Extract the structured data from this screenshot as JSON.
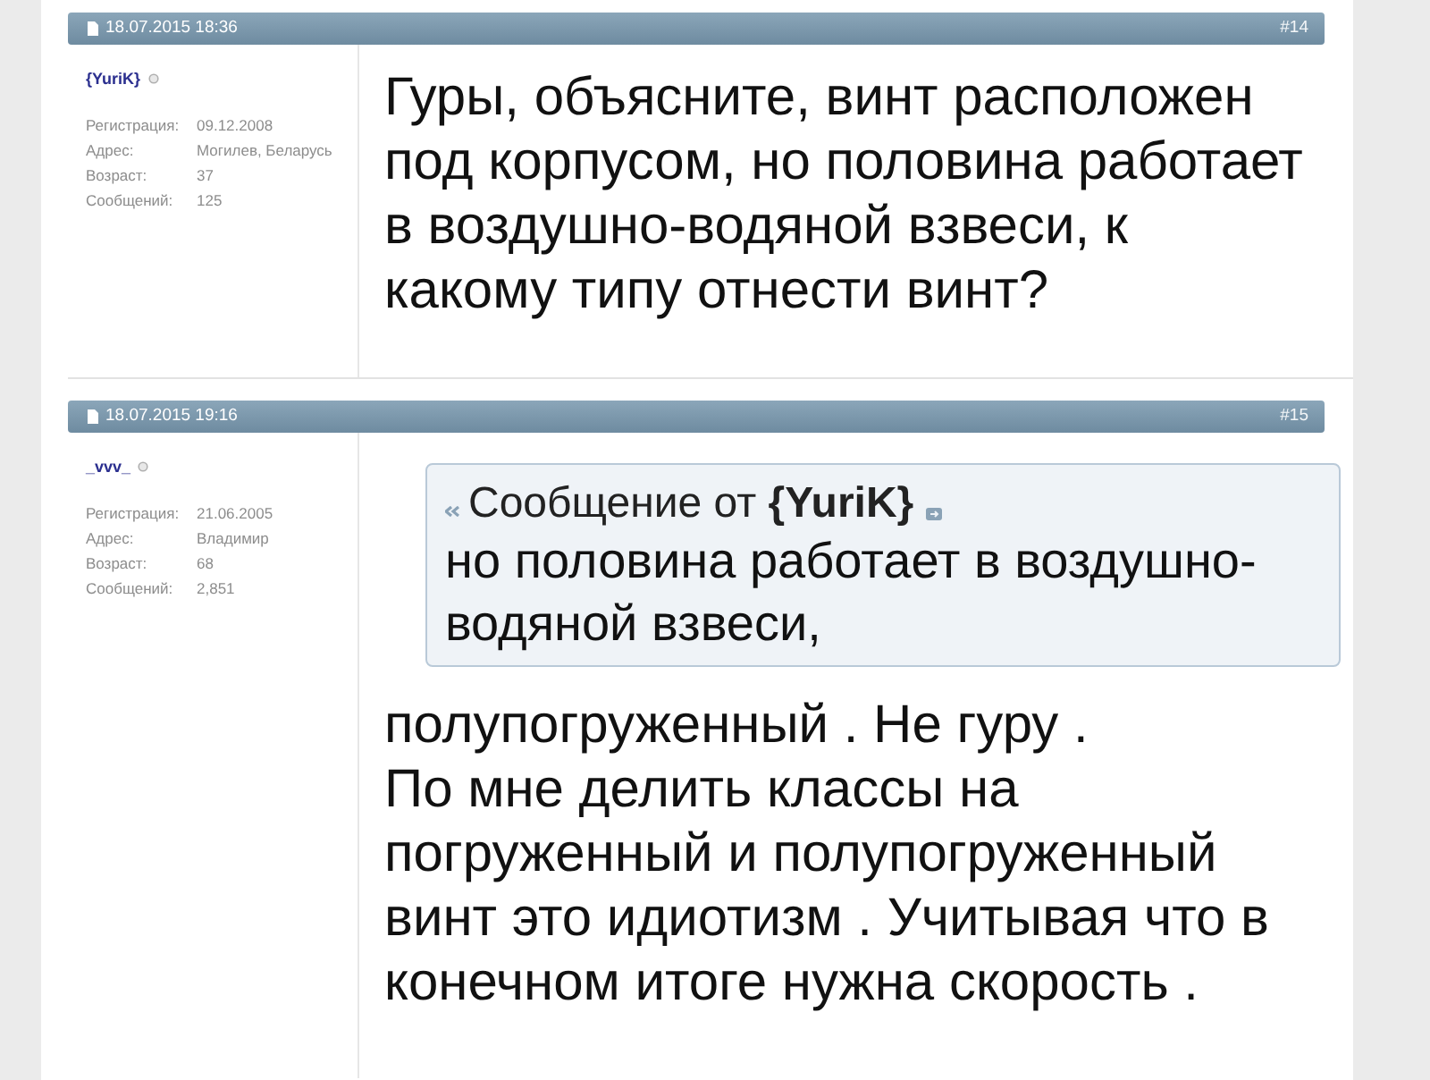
{
  "posts": [
    {
      "date": "18.07.2015 18:36",
      "number": "#14",
      "user": {
        "name": "{YuriK}",
        "online": false,
        "info": [
          {
            "label": "Регистрация:",
            "value": "09.12.2008"
          },
          {
            "label": "Адрес:",
            "value": "Могилев, Беларусь"
          },
          {
            "label": "Возраст:",
            "value": "37"
          },
          {
            "label": "Сообщений:",
            "value": "125"
          }
        ]
      },
      "text": "Гуры, объясните, винт расположен под корпусом, но половина работает в воздушно-водяной взвеси, к какому типу отнести винт?"
    },
    {
      "date": "18.07.2015 19:16",
      "number": "#15",
      "user": {
        "name": "_vvv_",
        "online": false,
        "info": [
          {
            "label": "Регистрация:",
            "value": "21.06.2005"
          },
          {
            "label": "Адрес:",
            "value": "Владимир"
          },
          {
            "label": "Возраст:",
            "value": "68"
          },
          {
            "label": "Сообщений:",
            "value": "2,851"
          }
        ]
      },
      "quote": {
        "header": "Сообщение от **{YuriK}**",
        "text": "но половина работает в воздушно-водяной взвеси,"
      },
      "text": "полупогруженный . Не гуру .\nПо мне делить классы на погруженный и полупогруженный винт это идиотизм . Учитывая что в конечном итоге нужна скорость ."
    }
  ]
}
